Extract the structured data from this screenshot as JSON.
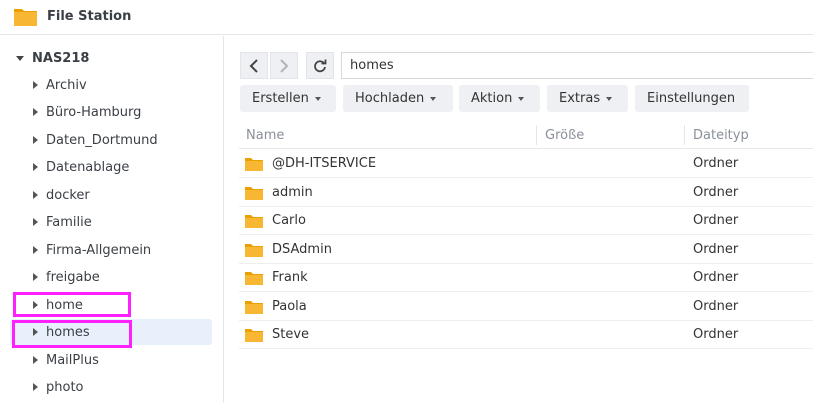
{
  "app": {
    "title": "File Station",
    "icon": "folder-icon"
  },
  "sidebar": {
    "root_label": "NAS218",
    "items": [
      {
        "label": "Archiv"
      },
      {
        "label": "Büro-Hamburg"
      },
      {
        "label": "Daten_Dortmund"
      },
      {
        "label": "Datenablage"
      },
      {
        "label": "docker"
      },
      {
        "label": "Familie"
      },
      {
        "label": "Firma-Allgemein"
      },
      {
        "label": "freigabe"
      },
      {
        "label": "home"
      },
      {
        "label": "homes",
        "selected": true
      },
      {
        "label": "MailPlus"
      },
      {
        "label": "photo"
      }
    ]
  },
  "navigation": {
    "back_icon": "chevron-left-icon",
    "forward_icon": "chevron-right-icon",
    "refresh_icon": "refresh-icon",
    "path": "homes"
  },
  "toolbar": {
    "create_label": "Erstellen",
    "upload_label": "Hochladen",
    "action_label": "Aktion",
    "extras_label": "Extras",
    "settings_label": "Einstellungen"
  },
  "table": {
    "columns": [
      "Name",
      "Größe",
      "Dateityp"
    ],
    "rows": [
      {
        "name": "@DH-ITSERVICE",
        "size": "",
        "type": "Ordner"
      },
      {
        "name": "admin",
        "size": "",
        "type": "Ordner"
      },
      {
        "name": "Carlo",
        "size": "",
        "type": "Ordner"
      },
      {
        "name": "DSAdmin",
        "size": "",
        "type": "Ordner"
      },
      {
        "name": "Frank",
        "size": "",
        "type": "Ordner"
      },
      {
        "name": "Paola",
        "size": "",
        "type": "Ordner"
      },
      {
        "name": "Steve",
        "size": "",
        "type": "Ordner"
      }
    ]
  },
  "colors": {
    "highlight": "#ff20ff",
    "folder": "#f7b733",
    "selected_bg": "#e8f1fb"
  }
}
